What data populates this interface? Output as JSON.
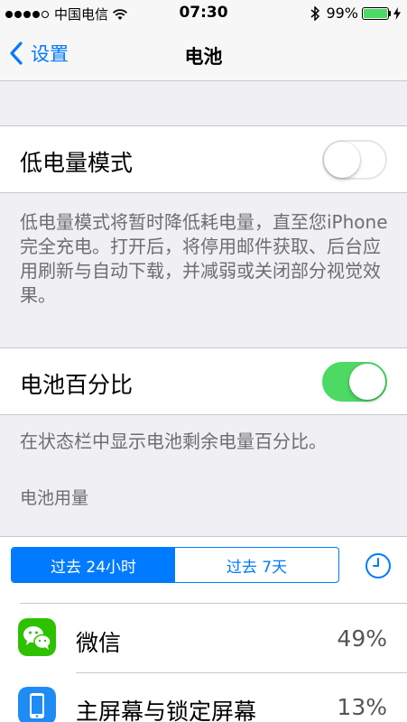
{
  "status_bar": {
    "carrier": "中国电信",
    "time": "07:30",
    "battery_percent": "99%",
    "battery_level": 0.99,
    "signal_bars_filled": 4,
    "signal_bars_total": 5
  },
  "nav": {
    "back_label": "设置",
    "title": "电池"
  },
  "low_power": {
    "label": "低电量模式",
    "enabled": false,
    "description": "低电量模式将暂时降低耗电量，直至您iPhone 完全充电。打开后，将停用邮件获取、后台应用刷新与自动下载，并减弱或关闭部分视觉效果。"
  },
  "battery_percentage": {
    "label": "电池百分比",
    "enabled": true,
    "description": "在状态栏中显示电池剩余电量百分比。"
  },
  "usage": {
    "header": "电池用量",
    "tabs": [
      {
        "label": "过去 24小时",
        "active": true
      },
      {
        "label": "过去 7天",
        "active": false
      }
    ],
    "apps": [
      {
        "name": "微信",
        "percent": "49%",
        "icon": "wechat-icon"
      },
      {
        "name": "主屏幕与锁定屏幕",
        "percent": "13%",
        "icon": "home-lock-screen-icon"
      }
    ]
  },
  "colors": {
    "accent": "#007aff",
    "toggle_on": "#4cd964",
    "wechat": "#2dc100"
  }
}
